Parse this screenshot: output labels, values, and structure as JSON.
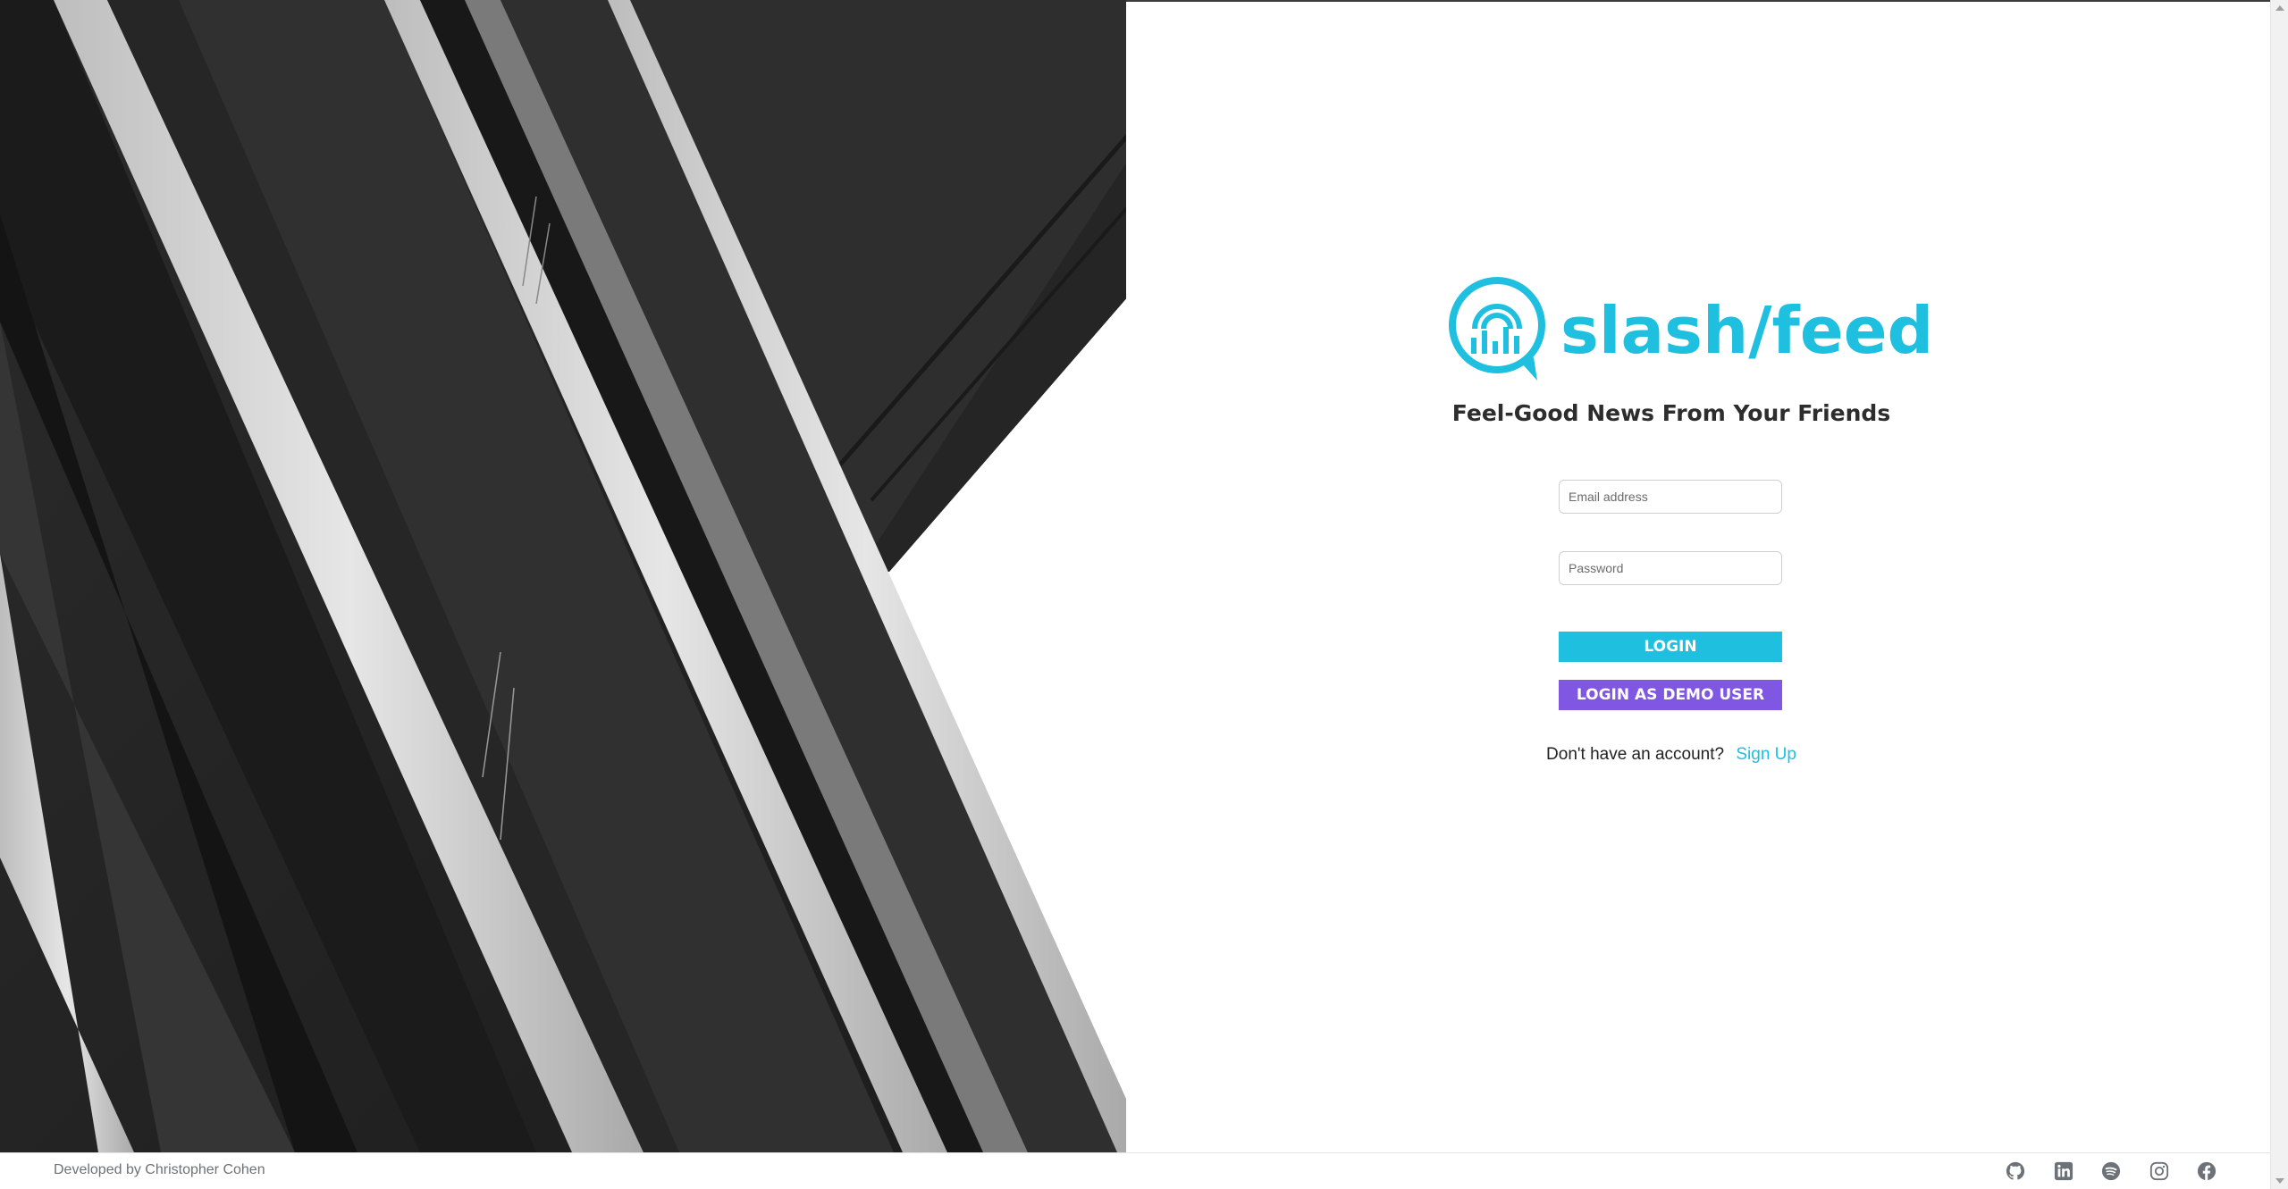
{
  "brand": {
    "name": "slash/feed",
    "tagline": "Feel-Good News From Your Friends",
    "accent_color": "#1fbfe0",
    "icon": "chat-bubble-chart-icon"
  },
  "login_form": {
    "email_placeholder": "Email address",
    "password_placeholder": "Password",
    "login_label": "LOGIN",
    "demo_label": "LOGIN AS DEMO USER",
    "demo_color": "#7f57e3",
    "signup_prompt": "Don't have an account?",
    "signup_link": "Sign Up"
  },
  "footer": {
    "credit": "Developed by Christopher Cohen",
    "social_icons": [
      "github-icon",
      "linkedin-icon",
      "spotify-icon",
      "instagram-icon",
      "facebook-icon"
    ]
  }
}
